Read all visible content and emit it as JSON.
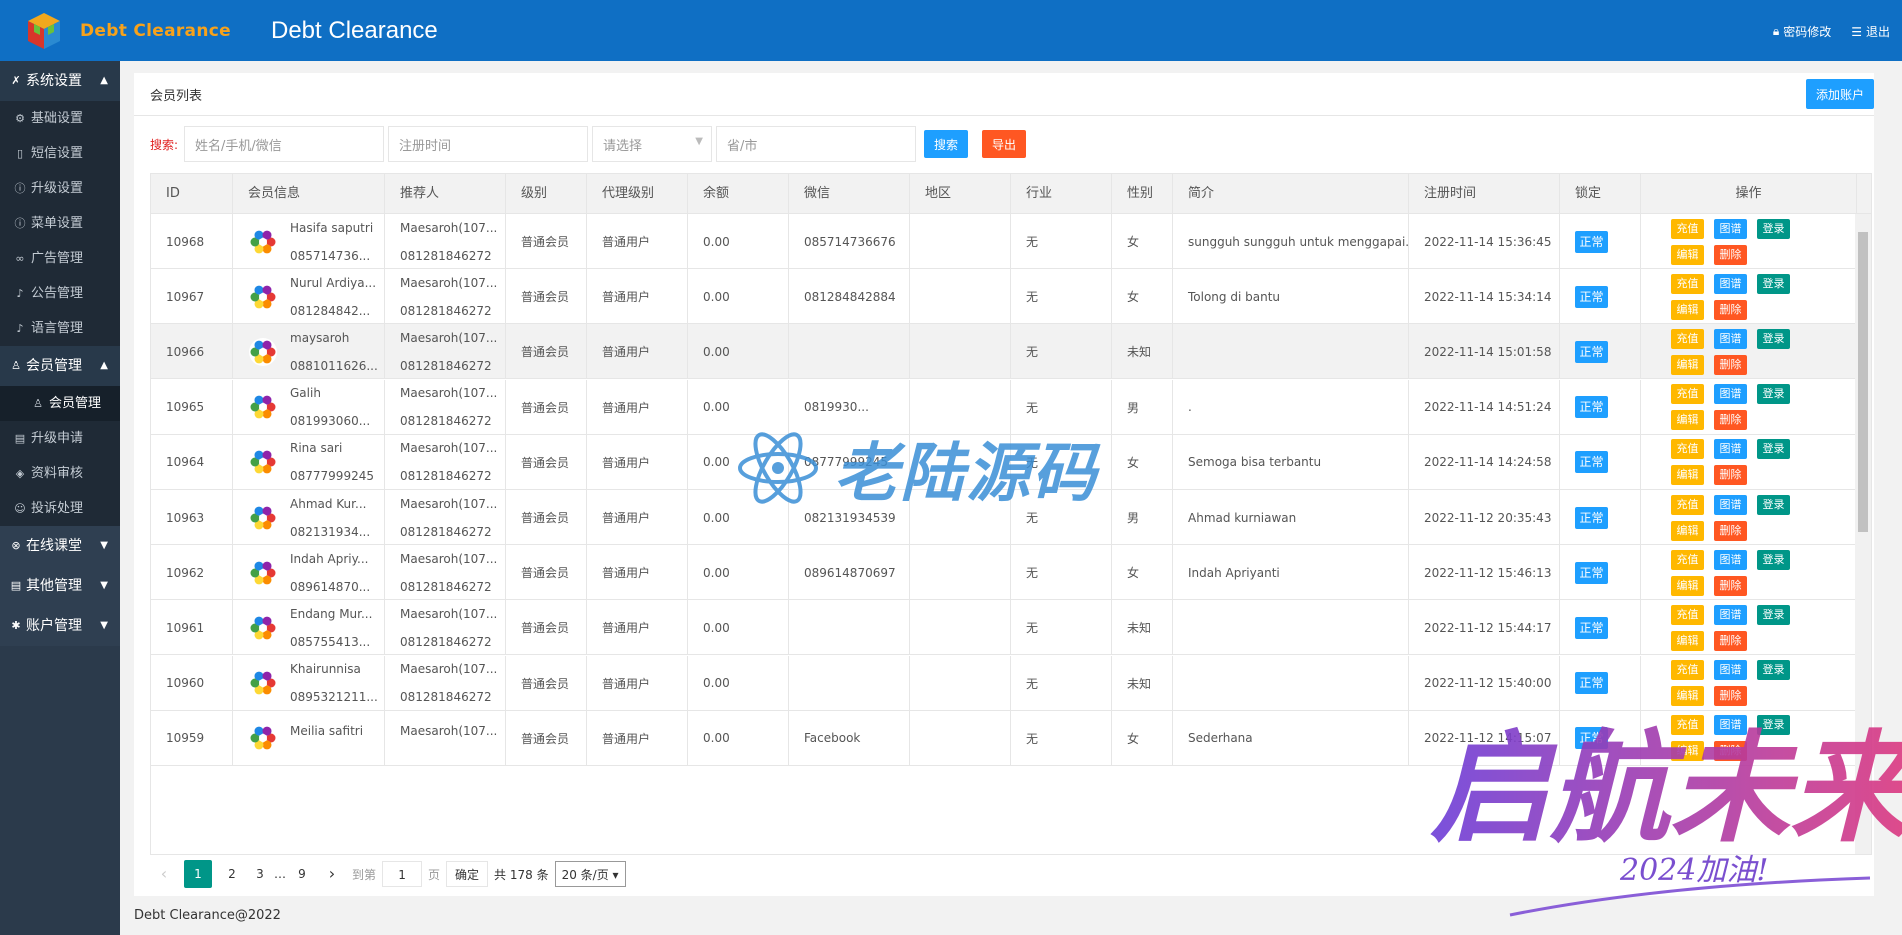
{
  "header": {
    "logo_text": "Debt Clearance",
    "title": "Debt Clearance",
    "change_password": "密码修改",
    "logout": "退出"
  },
  "sidebar": {
    "groups": [
      {
        "label": "系统设置",
        "items": [
          "基础设置",
          "短信设置",
          "升级设置",
          "菜单设置",
          "广告管理",
          "公告管理",
          "语言管理"
        ]
      },
      {
        "label": "会员管理",
        "items": [
          "会员管理",
          "升级申请",
          "资料审核",
          "投诉处理"
        ]
      },
      {
        "label": "在线课堂"
      },
      {
        "label": "其他管理"
      },
      {
        "label": "账户管理"
      }
    ]
  },
  "panel": {
    "title": "会员列表",
    "add_button": "添加账户"
  },
  "search": {
    "label": "搜索:",
    "name_placeholder": "姓名/手机/微信",
    "date_placeholder": "注册时间",
    "select_placeholder": "请选择",
    "region_placeholder": "省/市",
    "search_button": "搜索",
    "export_button": "导出"
  },
  "table": {
    "columns": [
      "ID",
      "会员信息",
      "推荐人",
      "级别",
      "代理级别",
      "余额",
      "微信",
      "地区",
      "行业",
      "性别",
      "简介",
      "注册时间",
      "锁定",
      "操作"
    ],
    "actions": [
      "充值",
      "图谱",
      "登录",
      "编辑",
      "删除"
    ],
    "rows": [
      {
        "id": "10968",
        "name": "Hasifa saputri",
        "phone": "085714736...",
        "ref_name": "Maesaroh(107...",
        "ref_phone": "081281846272",
        "level": "普通会员",
        "agent": "普通用户",
        "balance": "0.00",
        "wechat": "085714736676",
        "region": "",
        "industry": "无",
        "gender": "女",
        "bio": "sungguh sungguh untuk menggapai...",
        "date": "2022-11-14 15:36:45",
        "lock": "正常"
      },
      {
        "id": "10967",
        "name": "Nurul Ardiya...",
        "phone": "081284842...",
        "ref_name": "Maesaroh(107...",
        "ref_phone": "081281846272",
        "level": "普通会员",
        "agent": "普通用户",
        "balance": "0.00",
        "wechat": "081284842884",
        "region": "",
        "industry": "无",
        "gender": "女",
        "bio": "Tolong di bantu",
        "date": "2022-11-14 15:34:14",
        "lock": "正常"
      },
      {
        "id": "10966",
        "name": "maysaroh",
        "phone": "0881011626...",
        "ref_name": "Maesaroh(107...",
        "ref_phone": "081281846272",
        "level": "普通会员",
        "agent": "普通用户",
        "balance": "0.00",
        "wechat": "",
        "region": "",
        "industry": "无",
        "gender": "未知",
        "bio": "",
        "date": "2022-11-14 15:01:58",
        "lock": "正常"
      },
      {
        "id": "10965",
        "name": "Galih",
        "phone": "081993060...",
        "ref_name": "Maesaroh(107...",
        "ref_phone": "081281846272",
        "level": "普通会员",
        "agent": "普通用户",
        "balance": "0.00",
        "wechat": "0819930...",
        "region": "",
        "industry": "无",
        "gender": "男",
        "bio": ".",
        "date": "2022-11-14 14:51:24",
        "lock": "正常"
      },
      {
        "id": "10964",
        "name": "Rina sari",
        "phone": "08777999245",
        "ref_name": "Maesaroh(107...",
        "ref_phone": "081281846272",
        "level": "普通会员",
        "agent": "普通用户",
        "balance": "0.00",
        "wechat": "08777999245",
        "region": "",
        "industry": "无",
        "gender": "女",
        "bio": "Semoga bisa terbantu",
        "date": "2022-11-14 14:24:58",
        "lock": "正常"
      },
      {
        "id": "10963",
        "name": "Ahmad Kur...",
        "phone": "082131934...",
        "ref_name": "Maesaroh(107...",
        "ref_phone": "081281846272",
        "level": "普通会员",
        "agent": "普通用户",
        "balance": "0.00",
        "wechat": "082131934539",
        "region": "",
        "industry": "无",
        "gender": "男",
        "bio": "Ahmad kurniawan",
        "date": "2022-11-12 20:35:43",
        "lock": "正常"
      },
      {
        "id": "10962",
        "name": "Indah Apriy...",
        "phone": "089614870...",
        "ref_name": "Maesaroh(107...",
        "ref_phone": "081281846272",
        "level": "普通会员",
        "agent": "普通用户",
        "balance": "0.00",
        "wechat": "089614870697",
        "region": "",
        "industry": "无",
        "gender": "女",
        "bio": "Indah Apriyanti",
        "date": "2022-11-12 15:46:13",
        "lock": "正常"
      },
      {
        "id": "10961",
        "name": "Endang Mur...",
        "phone": "085755413...",
        "ref_name": "Maesaroh(107...",
        "ref_phone": "081281846272",
        "level": "普通会员",
        "agent": "普通用户",
        "balance": "0.00",
        "wechat": "",
        "region": "",
        "industry": "无",
        "gender": "未知",
        "bio": "",
        "date": "2022-11-12 15:44:17",
        "lock": "正常"
      },
      {
        "id": "10960",
        "name": "Khairunnisa",
        "phone": "0895321211...",
        "ref_name": "Maesaroh(107...",
        "ref_phone": "081281846272",
        "level": "普通会员",
        "agent": "普通用户",
        "balance": "0.00",
        "wechat": "",
        "region": "",
        "industry": "无",
        "gender": "未知",
        "bio": "",
        "date": "2022-11-12 15:40:00",
        "lock": "正常"
      },
      {
        "id": "10959",
        "name": "Meilia safitri",
        "phone": "",
        "ref_name": "Maesaroh(107...",
        "ref_phone": "",
        "level": "普通会员",
        "agent": "普通用户",
        "balance": "0.00",
        "wechat": "Facebook",
        "region": "",
        "industry": "无",
        "gender": "女",
        "bio": "Sederhana",
        "date": "2022-11-12 14:15:07",
        "lock": "正常"
      }
    ]
  },
  "pager": {
    "prev": "‹",
    "pages": [
      "1",
      "2",
      "3"
    ],
    "ellipsis": "…",
    "last": "9",
    "next": "›",
    "goto_label": "到第",
    "goto_value": "1",
    "page_unit": "页",
    "confirm": "确定",
    "total": "共 178 条",
    "per_page": "20 条/页 ▾"
  },
  "footer": {
    "text": "Debt Clearance@2022"
  },
  "watermarks": {
    "center_text": "老陆源码",
    "corner_text": "启航未来",
    "corner_sub": "2024加油!"
  },
  "colors": {
    "header": "#0f6fc4",
    "sidebar": "#2b3a4b",
    "primary": "#1e9fff",
    "warn": "#ffb800",
    "success": "#009688",
    "danger": "#ff5722"
  }
}
